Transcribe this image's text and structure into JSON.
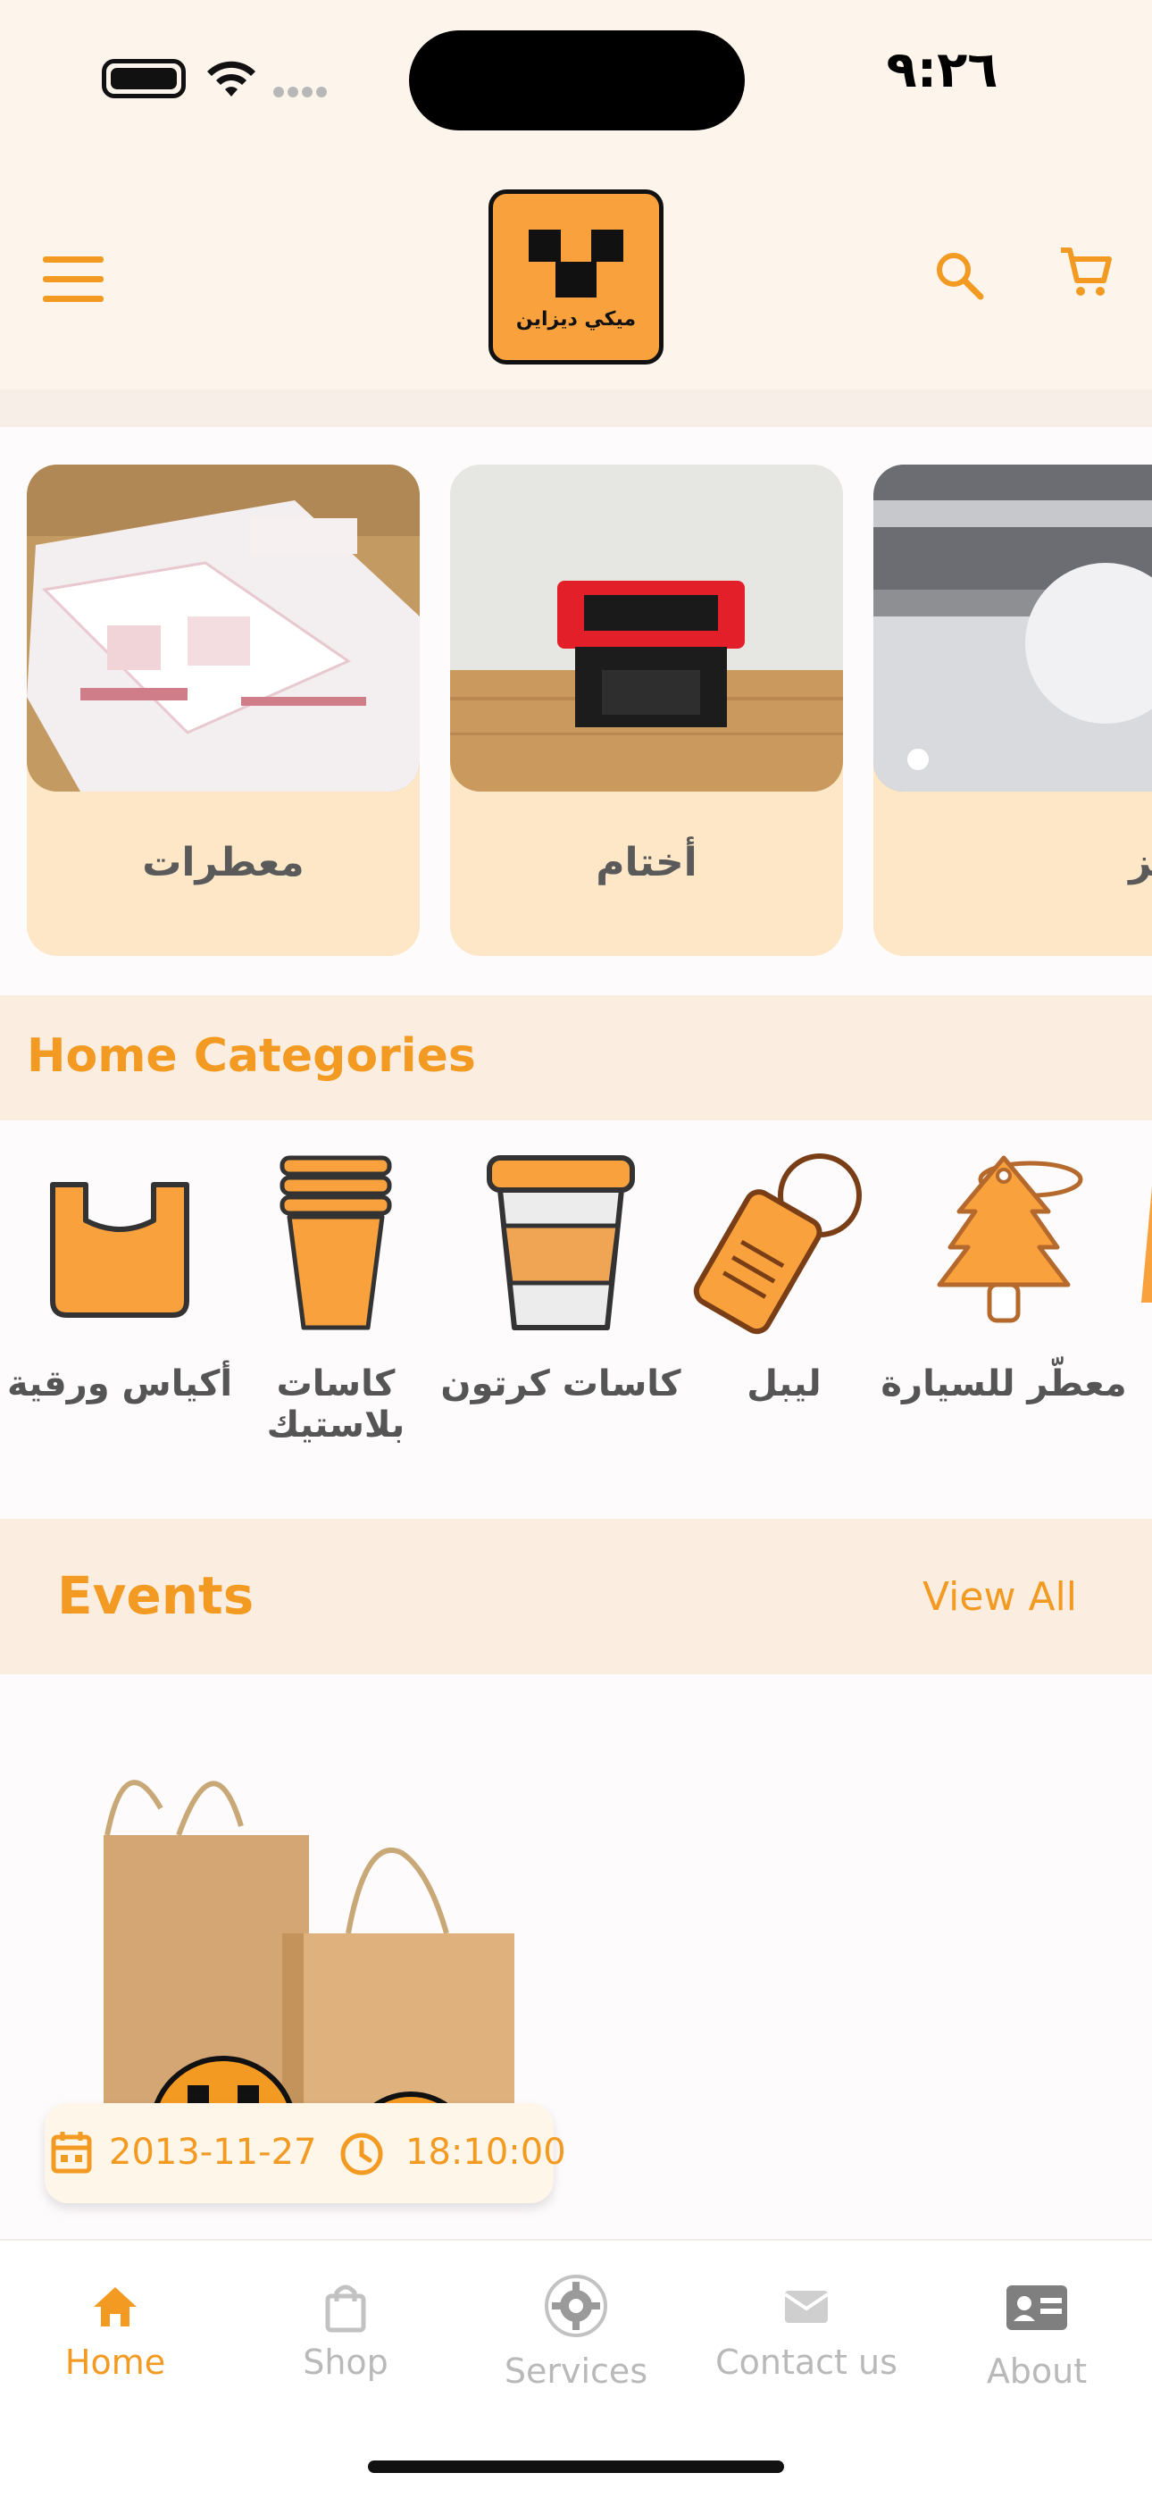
{
  "status_bar": {
    "time": "٩:٢٦"
  },
  "app_bar": {
    "logo_text": "ميكي ديزاين"
  },
  "featured": {
    "items": [
      {
        "label": "معطرات"
      },
      {
        "label": "أختام"
      },
      {
        "label": "بلايز"
      }
    ]
  },
  "home_categories": {
    "title": "Home Categories",
    "items": [
      {
        "label": "أكياس ورقية"
      },
      {
        "label": "كاسات بلاستيك"
      },
      {
        "label": "كاسات كرتون"
      },
      {
        "label": "ليبل"
      },
      {
        "label": "معطّر للسيارة"
      }
    ]
  },
  "events": {
    "title": "Events",
    "view_all": "View All",
    "items": [
      {
        "date": "2013-11-27",
        "time": "18:10:00"
      }
    ]
  },
  "bottom_nav": {
    "items": [
      {
        "label": "Home",
        "active": true
      },
      {
        "label": "Shop",
        "active": false
      },
      {
        "label": "Services",
        "active": false
      },
      {
        "label": "Contact us",
        "active": false
      },
      {
        "label": "About",
        "active": false
      }
    ]
  },
  "colors": {
    "accent": "#f39a22",
    "header_bg": "#fdf5ec",
    "section_bg": "#fbeee0",
    "card_bg": "#fde7c6",
    "inactive": "#b9b9b9"
  }
}
